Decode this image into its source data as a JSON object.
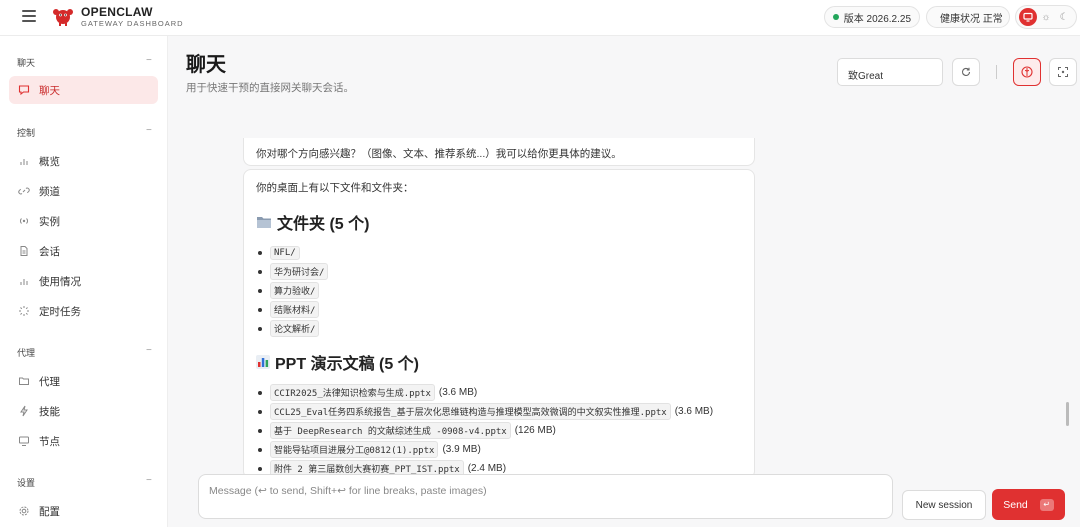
{
  "topbar": {
    "brand_name": "OPENCLAW",
    "brand_sub": "GATEWAY DASHBOARD",
    "version_label": "版本 2026.2.25",
    "health_label": "健康状况 正常"
  },
  "sidebar": {
    "sections": [
      {
        "title": "聊天",
        "items": [
          {
            "label": "聊天",
            "icon": "chat-bubble-icon",
            "active": true
          }
        ]
      },
      {
        "title": "控制",
        "items": [
          {
            "label": "概览",
            "icon": "bar-chart-icon"
          },
          {
            "label": "频道",
            "icon": "link-icon"
          },
          {
            "label": "实例",
            "icon": "broadcast-icon"
          },
          {
            "label": "会话",
            "icon": "document-icon"
          },
          {
            "label": "使用情况",
            "icon": "bar-chart-icon"
          },
          {
            "label": "定时任务",
            "icon": "spinner-icon"
          }
        ]
      },
      {
        "title": "代理",
        "items": [
          {
            "label": "代理",
            "icon": "folder-icon"
          },
          {
            "label": "技能",
            "icon": "lightning-icon"
          },
          {
            "label": "节点",
            "icon": "monitor-icon"
          }
        ]
      },
      {
        "title": "设置",
        "items": [
          {
            "label": "配置",
            "icon": "gear-icon"
          }
        ]
      }
    ],
    "collapse_glyph": "−"
  },
  "header": {
    "title": "聊天",
    "subtitle": "用于快速干预的直接网关聊天会话。",
    "session_value": "致Great"
  },
  "messages": {
    "prev_text": "你对哪个方向感兴趣？（图像、文本、推荐系统...）我可以给你更具体的建议。",
    "intro": "你的桌面上有以下文件和文件夹：",
    "folders_heading": "文件夹 (5 个)",
    "folders": [
      "NFL/",
      "华为研讨会/",
      "算力验收/",
      "结账材料/",
      "论文解析/"
    ],
    "ppt_heading": "PPT 演示文稿 (5 个)",
    "ppts": [
      {
        "name": "CCIR2025_法律知识检索与生成.pptx",
        "size": "(3.6 MB)"
      },
      {
        "name": "CCL25_Eval任务四系统报告_基于层次化思维链构造与推理模型高效微调的中文叙实性推理.pptx",
        "size": "(3.6 MB)"
      },
      {
        "name": "基于 DeepResearch 的文献综述生成 -0908-v4.pptx",
        "size": "(126 MB)"
      },
      {
        "name": "智能导钻项目进展分工@0812(1).pptx",
        "size": "(3.9 MB)"
      },
      {
        "name": "附件 2 第三届数创大赛初赛_PPT_IST.pptx",
        "size": "(2.4 MB)"
      }
    ]
  },
  "composer": {
    "placeholder": "Message (↩ to send, Shift+↩ for line breaks, paste images)",
    "new_session": "New session",
    "send": "Send",
    "send_key": "↵"
  },
  "colors": {
    "accent": "#e03131",
    "status_ok": "#22a55a"
  }
}
